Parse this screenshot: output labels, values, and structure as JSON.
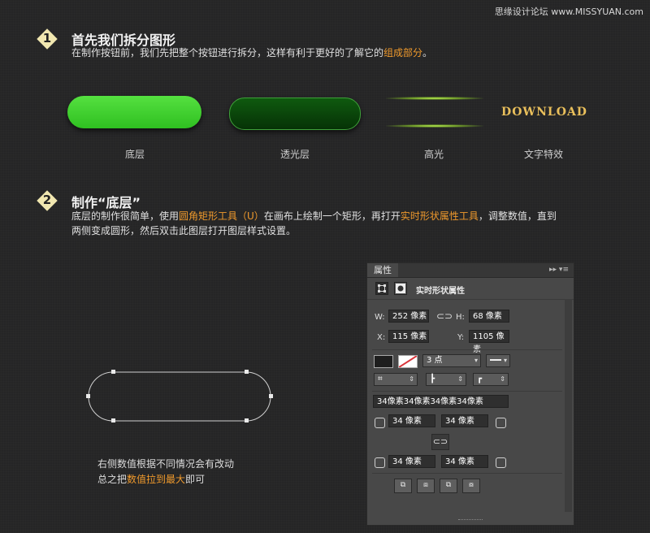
{
  "watermark": "思缘设计论坛 www.MISSYUAN.com",
  "step1": {
    "number": "1",
    "title": "首先我们拆分图形",
    "desc_prefix": "在制作按钮前，我们先把整个按钮进行拆分，这样有利于更好的了解它的",
    "desc_highlight": "组成部分",
    "desc_suffix": "。"
  },
  "parts": {
    "download_text": "DOWNLOAD",
    "captions": [
      "底层",
      "透光层",
      "高光",
      "文字特效"
    ]
  },
  "step2": {
    "number": "2",
    "title": "制作“底层”",
    "line1_a": "底层的制作很简单，使用",
    "line1_hl1": "圆角矩形工具（U）",
    "line1_b": "在画布上绘制一个矩形，再打开",
    "line1_hl2": "实时形状属性工具",
    "line1_c": "，调整数值，直到",
    "line2": "两侧变成圆形，然后双击此图层打开图层样式设置。"
  },
  "note": {
    "line1": "右侧数值根据不同情况会有改动",
    "line2_a": "总之把",
    "line2_hl": "数值拉到最大",
    "line2_b": "即可"
  },
  "panel": {
    "tab": "属性",
    "menu": "▸▸ ▾≡",
    "title": "实时形状属性",
    "w_label": "W:",
    "w_value": "252 像素",
    "h_label": "H:",
    "h_value": "68 像素",
    "x_label": "X:",
    "x_value": "115 像素",
    "y_label": "Y:",
    "y_value": "1105 像素",
    "stroke_size": "3 点",
    "corners_summary": "34像素34像素34像素34像素",
    "corner_tl": "34 像素",
    "corner_tr": "34 像素",
    "corner_bl": "34 像素",
    "corner_br": "34 像素",
    "colors": {
      "fill": "#1e1e1e",
      "stroke_x": "#d9343a",
      "accent": "#f09a2c"
    }
  },
  "icons": [
    "diamond-badge-icon",
    "link-icon",
    "path-ops-icons"
  ]
}
